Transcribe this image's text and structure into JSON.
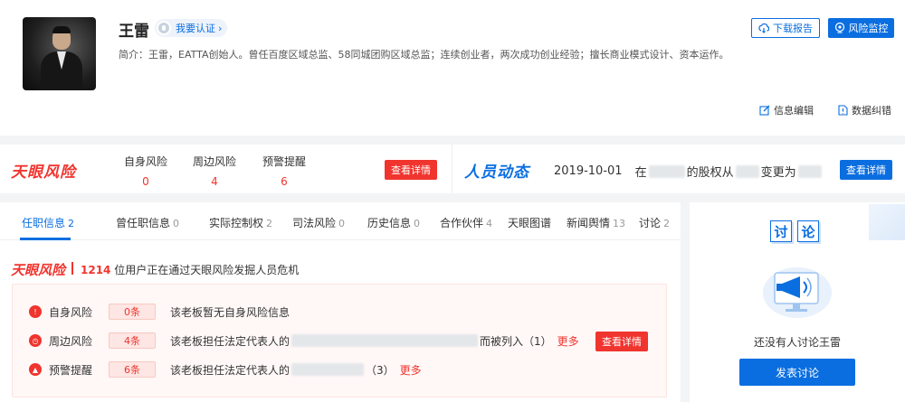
{
  "profile": {
    "name": "王雷",
    "verify_label": "我要认证",
    "intro": "简介：王雷，EATTA创始人。曾任百度区域总监、58同城团购区域总监；连续创业者，两次成功创业经验；擅长商业模式设计、资本运作。",
    "download_label": "下载报告",
    "monitor_label": "风险监控",
    "edit_label": "信息编辑",
    "correct_label": "数据纠错"
  },
  "risk_bar": {
    "logo": "天眼风险",
    "cols": [
      {
        "label": "自身风险",
        "value": "0"
      },
      {
        "label": "周边风险",
        "value": "4"
      },
      {
        "label": "预警提醒",
        "value": "6"
      }
    ],
    "button": "查看详情"
  },
  "dynamics": {
    "title": "人员动态",
    "date": "2019-10-01",
    "text_at": "在",
    "text_mid": "的股权从",
    "text_end": "变更为",
    "button": "查看详情"
  },
  "tabs": [
    {
      "label": "任职信息",
      "count": "2"
    },
    {
      "label": "曾任职信息",
      "count": "0"
    },
    {
      "label": "实际控制权",
      "count": "2"
    },
    {
      "label": "司法风险",
      "count": "0"
    },
    {
      "label": "历史信息",
      "count": "0"
    },
    {
      "label": "合作伙伴",
      "count": "4"
    },
    {
      "label": "天眼图谱",
      "count": ""
    },
    {
      "label": "新闻舆情",
      "count": "13"
    },
    {
      "label": "讨论",
      "count": "2"
    }
  ],
  "risk_watch": {
    "logo": "天眼风险",
    "user_count": "1214",
    "text": "位用户正在通过天眼风险发掘人员危机",
    "rows": [
      {
        "label": "自身风险",
        "tag": "0条",
        "desc": "该老板暂无自身风险信息",
        "more": ""
      },
      {
        "label": "周边风险",
        "tag": "4条",
        "desc": "该老板担任法定代表人的",
        "desc_tail": "而被列入（1）",
        "more": "更多"
      },
      {
        "label": "预警提醒",
        "tag": "6条",
        "desc": "该老板担任法定代表人的",
        "desc_tail": "（3）",
        "more": "更多"
      }
    ],
    "button": "查看详情"
  },
  "discussion": {
    "title_1": "讨",
    "title_2": "论",
    "empty_text": "还没有人讨论王雷",
    "post_button": "发表讨论"
  },
  "colors": {
    "brand_blue": "#0a6ee0",
    "risk_red": "#f0342e"
  },
  "icons": [
    "cloud-download-icon",
    "monitor-eye-icon",
    "edit-icon",
    "report-icon",
    "shield-icon",
    "clock-icon",
    "bell-icon",
    "megaphone-icon"
  ]
}
